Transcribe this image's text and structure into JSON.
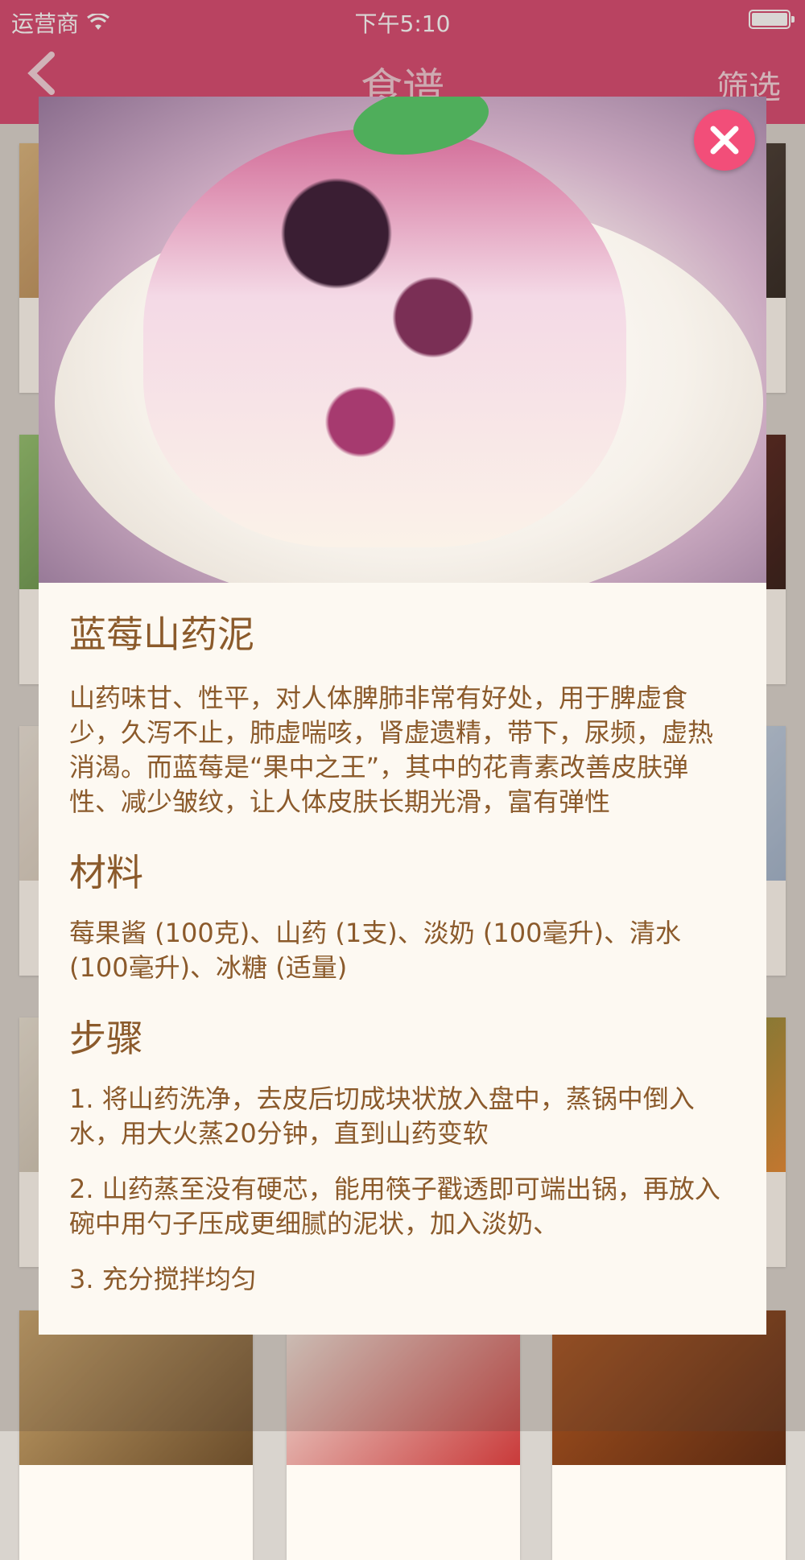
{
  "status_bar": {
    "carrier": "运营商",
    "time": "下午5:10"
  },
  "nav": {
    "back_icon": "chevron-left-icon",
    "title": "食谱",
    "filter_label": "筛选"
  },
  "modal": {
    "close_icon": "close-icon",
    "recipe_title": "蓝莓山药泥",
    "description": "山药味甘、性平，对人体脾肺非常有好处，用于脾虚食少，久泻不止，肺虚喘咳，肾虚遗精，带下，尿频，虚热消渴。而蓝莓是“果中之王”，其中的花青素改善皮肤弹性、减少皱纹，让人体皮肤长期光滑，富有弹性",
    "materials_heading": "材料",
    "materials": "莓果酱 (100克)、山药 (1支)、淡奶 (100毫升)、清水 (100毫升)、冰糖 (适量)",
    "steps_heading": "步骤",
    "steps": [
      "1. 将山药洗净，去皮后切成块状放入盘中，蒸锅中倒入水，用大火蒸20分钟，直到山药变软",
      "2. 山药蒸至没有硬芯，能用筷子戳透即可端出锅，再放入碗中用勺子压成更细腻的泥状，加入淡奶、",
      "3. 充分搅拌均匀"
    ]
  }
}
